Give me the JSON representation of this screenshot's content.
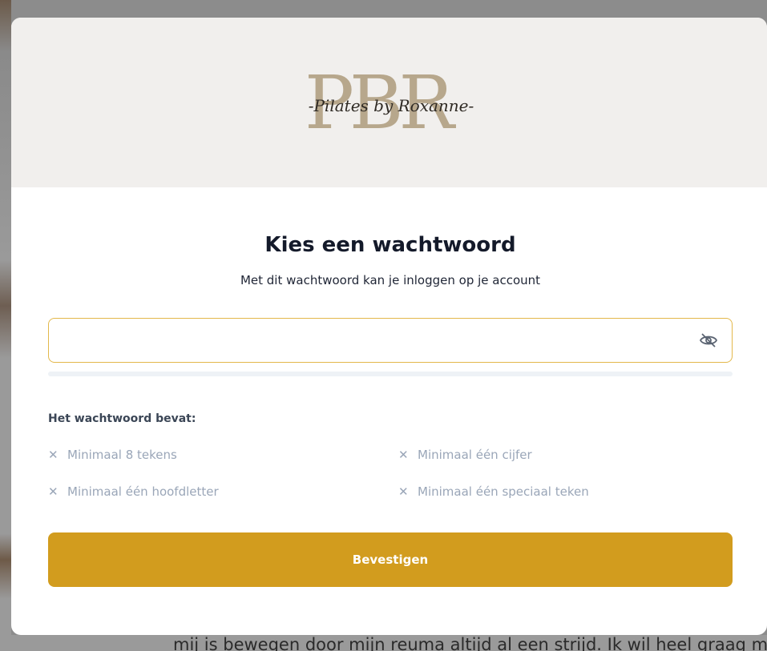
{
  "brand": {
    "logo_letters": "PBR",
    "logo_script": "-Pilates by Roxanne-"
  },
  "dialog": {
    "title": "Kies een wachtwoord",
    "subtitle": "Met dit wachtwoord kan je inloggen op je account",
    "password_value": "",
    "toggle_icon": "eye-slash-icon"
  },
  "requirements": {
    "heading": "Het wachtwoord bevat:",
    "items": [
      {
        "icon": "x",
        "label": "Minimaal 8 tekens"
      },
      {
        "icon": "x",
        "label": "Minimaal één cijfer"
      },
      {
        "icon": "x",
        "label": "Minimaal één hoofdletter"
      },
      {
        "icon": "x",
        "label": "Minimaal één speciaal teken"
      }
    ]
  },
  "actions": {
    "confirm_label": "Bevestigen"
  },
  "background": {
    "text": "mij is bewegen door mijn reuma altijd al een strijd. Ik wil heel graag maar zodra ik"
  },
  "colors": {
    "accent": "#d29c1e",
    "input_border": "#e3b84b",
    "header_bg": "#f1efed",
    "logo_gold": "#b7a78c",
    "muted": "#9aa6b8"
  }
}
